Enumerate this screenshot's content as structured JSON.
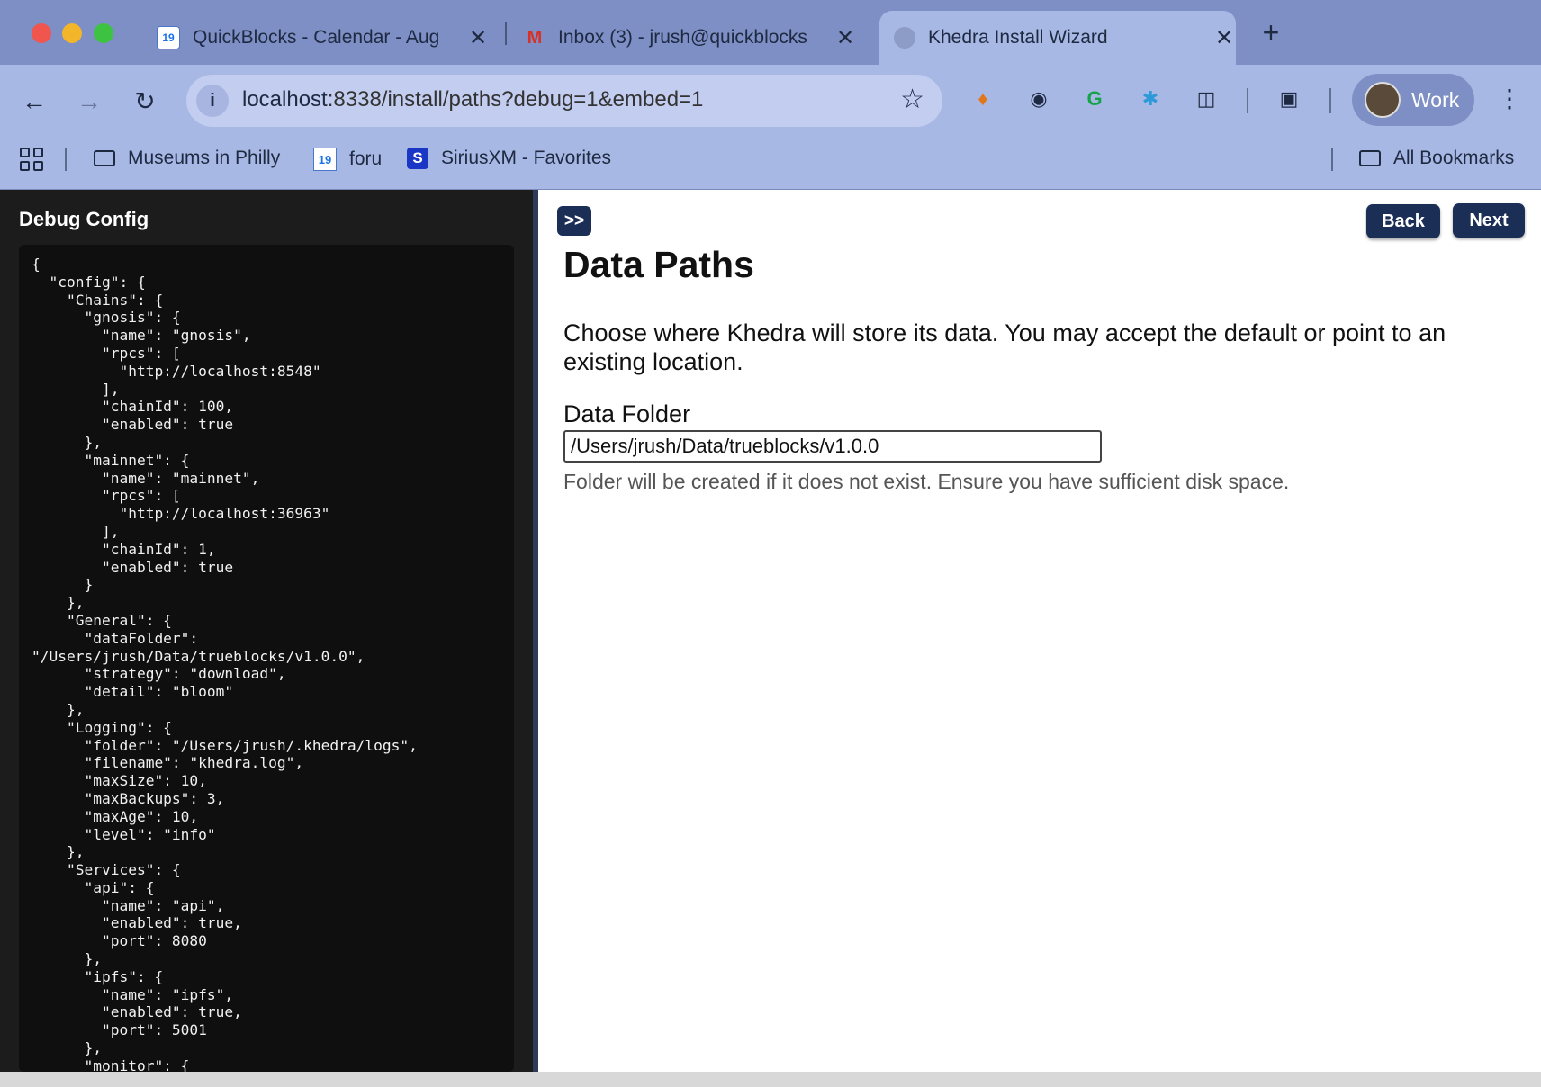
{
  "tabs": [
    {
      "title": "QuickBlocks - Calendar - Aug",
      "favicon": "calendar-icon",
      "favicon_text": "19",
      "close": "✕"
    },
    {
      "title": "Inbox (3) - jrush@quickblocks",
      "favicon": "gmail-icon",
      "favicon_text": "M",
      "close": "✕"
    },
    {
      "title": "Khedra Install Wizard",
      "favicon": "globe-icon",
      "favicon_text": "",
      "close": "✕"
    }
  ],
  "new_tab_label": "+",
  "toolbar": {
    "url_host": "localhost",
    "url_rest": ":8338/install/paths?debug=1&embed=1",
    "profile_label": "Work"
  },
  "bookmarks": {
    "items": [
      {
        "label": "Museums in Philly",
        "icon": "folder-icon"
      },
      {
        "label": "foru",
        "icon": "calendar-icon",
        "icon_text": "19"
      },
      {
        "label": "SiriusXM - Favorites",
        "icon": "siriusxm-icon",
        "icon_text": "S"
      }
    ],
    "all_bookmarks": "All Bookmarks"
  },
  "debug": {
    "title": "Debug Config",
    "json_text": "{\n  \"config\": {\n    \"Chains\": {\n      \"gnosis\": {\n        \"name\": \"gnosis\",\n        \"rpcs\": [\n          \"http://localhost:8548\"\n        ],\n        \"chainId\": 100,\n        \"enabled\": true\n      },\n      \"mainnet\": {\n        \"name\": \"mainnet\",\n        \"rpcs\": [\n          \"http://localhost:36963\"\n        ],\n        \"chainId\": 1,\n        \"enabled\": true\n      }\n    },\n    \"General\": {\n      \"dataFolder\":\n\"/Users/jrush/Data/trueblocks/v1.0.0\",\n      \"strategy\": \"download\",\n      \"detail\": \"bloom\"\n    },\n    \"Logging\": {\n      \"folder\": \"/Users/jrush/.khedra/logs\",\n      \"filename\": \"khedra.log\",\n      \"maxSize\": 10,\n      \"maxBackups\": 3,\n      \"maxAge\": 10,\n      \"level\": \"info\"\n    },\n    \"Services\": {\n      \"api\": {\n        \"name\": \"api\",\n        \"enabled\": true,\n        \"port\": 8080\n      },\n      \"ipfs\": {\n        \"name\": \"ipfs\",\n        \"enabled\": true,\n        \"port\": 5001\n      },\n      \"monitor\": {"
  },
  "wizard": {
    "toggle_label": ">>",
    "back_label": "Back",
    "next_label": "Next",
    "title": "Data Paths",
    "description": "Choose where Khedra will store its data. You may accept the default or point to an existing location.",
    "field_label": "Data Folder",
    "field_value": "/Users/jrush/Data/trueblocks/v1.0.0",
    "field_hint": "Folder will be created if it does not exist. Ensure you have sufficient disk space."
  },
  "colors": {
    "tabstrip": "#7d8fc4",
    "toolbar": "#a8b8e4",
    "button": "#1b2e55",
    "debug_bg": "#1c1c1c"
  }
}
